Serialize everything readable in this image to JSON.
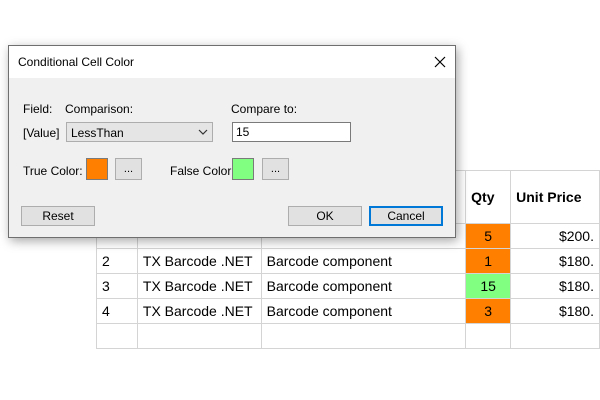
{
  "table": {
    "headers": {
      "qty": "Qty",
      "unit_price": "Unit Price"
    },
    "rows": [
      {
        "no": "2",
        "product": "TX Barcode .NET",
        "description": "Barcode component",
        "qty": "1",
        "price": "$180.",
        "qty_color": "#ff8000"
      },
      {
        "no": "3",
        "product": "TX Barcode .NET",
        "description": "Barcode component",
        "qty": "15",
        "price": "$180.",
        "qty_color": "#80ff80"
      },
      {
        "no": "4",
        "product": "TX Barcode .NET",
        "description": "Barcode component",
        "qty": "3",
        "price": "$180.",
        "qty_color": "#ff8000"
      }
    ],
    "partial_row": {
      "qty": "5",
      "price": "$200.",
      "qty_color": "#ff8000"
    }
  },
  "dialog": {
    "title": "Conditional Cell Color",
    "field_label": "Field:",
    "field_value": "[Value]",
    "comparison_label": "Comparison:",
    "comparison_value": "LessThan",
    "compare_to_label": "Compare to:",
    "compare_to_value": "15",
    "true_color_label": "True Color:",
    "true_color": "#ff8000",
    "false_color_label": "False Color:",
    "false_color": "#80ff80",
    "ellipsis_label": "...",
    "reset_label": "Reset",
    "ok_label": "OK",
    "cancel_label": "Cancel"
  },
  "icons": {
    "close": "close-icon",
    "dropdown": "chevron-down-icon"
  },
  "colors": {
    "dialog_bg": "#f0f0f0",
    "default_button_border": "#0078d7"
  }
}
